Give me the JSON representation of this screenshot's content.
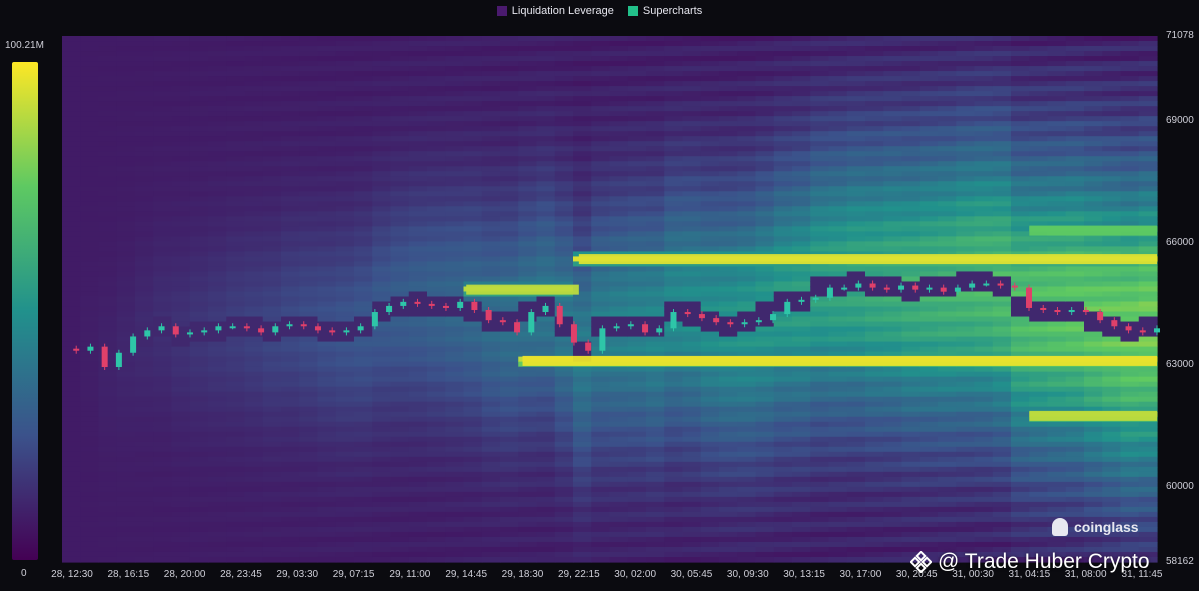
{
  "legend": {
    "items": [
      {
        "label": "Liquidation Leverage",
        "color": "#4a1a6e"
      },
      {
        "label": "Supercharts",
        "color": "#22c08a"
      }
    ]
  },
  "colorbar": {
    "max_label": "100.21M",
    "min_label": "0",
    "stops": [
      "#440154",
      "#3b528b",
      "#21918c",
      "#5ec962",
      "#fde725"
    ]
  },
  "brand": {
    "name": "coinglass"
  },
  "watermark": {
    "text": "@ Trade Huber Crypto"
  },
  "chart_data": {
    "type": "heatmap",
    "title": "",
    "y_axis": {
      "range": [
        58162,
        71078
      ],
      "tick_labels": [
        "71078",
        "69000",
        "66000",
        "63000",
        "60000",
        "58162"
      ],
      "tick_values": [
        71078,
        69000,
        66000,
        63000,
        60000,
        58162
      ]
    },
    "x_axis": {
      "tick_labels": [
        "28, 12:30",
        "28, 16:15",
        "28, 20:00",
        "28, 23:45",
        "29, 03:30",
        "29, 07:15",
        "29, 11:00",
        "29, 14:45",
        "29, 18:30",
        "29, 22:15",
        "30, 02:00",
        "30, 05:45",
        "30, 09:30",
        "30, 13:15",
        "30, 17:00",
        "30, 20:45",
        "31, 00:30",
        "31, 04:15",
        "31, 08:00",
        "31, 11:45"
      ]
    },
    "price_series": {
      "name": "Price",
      "values": [
        63400,
        63350,
        63450,
        62950,
        63300,
        63700,
        63850,
        63950,
        63750,
        63800,
        63850,
        63950,
        63950,
        63900,
        63800,
        63950,
        64000,
        63950,
        63850,
        63800,
        63850,
        63950,
        64300,
        64450,
        64550,
        64500,
        64450,
        64400,
        64550,
        64350,
        64100,
        64050,
        63800,
        64300,
        64450,
        64000,
        63550,
        63350,
        63900,
        63950,
        64000,
        63800,
        63900,
        64300,
        64250,
        64150,
        64050,
        64000,
        64050,
        64100,
        64250,
        64550,
        64600,
        64650,
        64900,
        64900,
        65000,
        64900,
        64850,
        64950,
        64850,
        64900,
        64800,
        64900,
        65000,
        65000,
        64950,
        64900,
        64400,
        64350,
        64300,
        64350,
        64300,
        64100,
        63950,
        63850,
        63800,
        63900
      ]
    },
    "liquidation_bands": [
      {
        "level": 65600,
        "start_index": 9,
        "end_index": 20,
        "intensity": 0.95
      },
      {
        "level": 64850,
        "start_index": 7,
        "end_index": 9,
        "intensity": 0.9
      },
      {
        "level": 63100,
        "start_index": 8,
        "end_index": 20,
        "intensity": 0.97
      },
      {
        "level": 61750,
        "start_index": 17,
        "end_index": 20,
        "intensity": 0.9
      },
      {
        "level": 66300,
        "start_index": 17,
        "end_index": 20,
        "intensity": 0.75
      }
    ]
  }
}
